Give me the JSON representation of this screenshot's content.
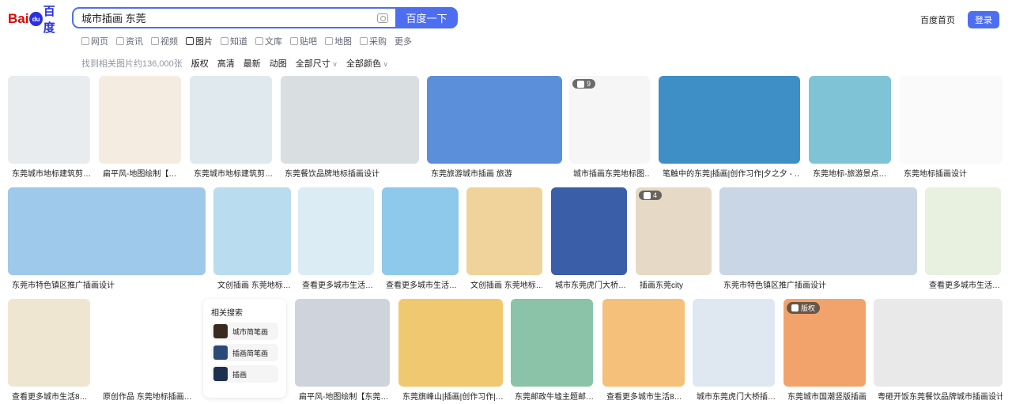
{
  "header": {
    "logo_bai": "Bai",
    "logo_du": "du",
    "logo_cn": "百度",
    "search_query": "城市插画 东莞",
    "search_button": "百度一下",
    "home_link": "百度首页",
    "login_button": "登录"
  },
  "tabs": [
    {
      "label": "网页",
      "icon": "search-icon"
    },
    {
      "label": "资讯",
      "icon": "news-icon"
    },
    {
      "label": "视频",
      "icon": "video-icon"
    },
    {
      "label": "图片",
      "icon": "image-icon",
      "active": true
    },
    {
      "label": "知道",
      "icon": "question-icon"
    },
    {
      "label": "文库",
      "icon": "document-icon"
    },
    {
      "label": "贴吧",
      "icon": "forum-icon"
    },
    {
      "label": "地图",
      "icon": "map-icon"
    },
    {
      "label": "采购",
      "icon": "shop-icon"
    },
    {
      "label": "更多",
      "icon": ""
    }
  ],
  "filters": {
    "count": "找到相关图片约136,000张",
    "copyright": "版权",
    "hd": "高清",
    "latest": "最新",
    "animated": "动图",
    "size": "全部尺寸",
    "color": "全部颜色"
  },
  "colors": {
    "accent": "#4e6ef2",
    "logo_red": "#e10601",
    "logo_blue": "#2932e1"
  },
  "images": [
    {
      "caption": "东莞城市地标建筑剪…",
      "bg": "#e8ecef"
    },
    {
      "caption": "扁平风-地图绘制【…",
      "bg": "#f4ece0"
    },
    {
      "caption": "东莞城市地标建筑剪…",
      "bg": "#dfe9ee"
    },
    {
      "caption": "东莞餐饮品牌地标插画设计",
      "bg": "#d9dfe0"
    },
    {
      "caption": "东莞旅游城市插画 旅游",
      "bg": "#5b8fd9"
    },
    {
      "caption": "城市插画东莞地标图…",
      "bg": "#f6f6f6",
      "badge": "9"
    },
    {
      "caption": "笔触中的东莞|插画|创作习作|夕之夕 - …",
      "bg": "#3f8fc7"
    },
    {
      "caption": "东莞地标-旅游景点…",
      "bg": "#7fc4d6"
    },
    {
      "caption": "东莞地标插画设计",
      "bg": "#fafafa"
    },
    {
      "caption": "东莞市特色镇区推广插画设计",
      "bg": "#9ec9ea"
    },
    {
      "caption": "文创插画 东莞地标…",
      "bg": "#b9dcee"
    },
    {
      "caption": "查看更多城市生活…",
      "bg": "#dcecf4"
    },
    {
      "caption": "查看更多城市生活…",
      "bg": "#8ec8ea"
    },
    {
      "caption": "文创插画 东莞地标…",
      "bg": "#f0d39a"
    },
    {
      "caption": "城市东莞虎门大桥…",
      "bg": "#3b5ea8"
    },
    {
      "caption": "插画东莞city",
      "bg": "#e6d9c6",
      "badge": "4"
    },
    {
      "caption": "东莞市特色镇区推广插画设计",
      "bg": "#c8d6e6"
    },
    {
      "caption": "查看更多城市生活…",
      "bg": "#e8f0e0"
    },
    {
      "caption": "查看更多城市生活8…",
      "bg": "#efe6d2"
    },
    {
      "caption": "原创作品 东莞地标插画…",
      "bg": "#ffffff"
    },
    {
      "caption": "扁平风-地图绘制【东莞…",
      "bg": "#cfd3db"
    },
    {
      "caption": "东莞旗峰山|插画|创作习作|…",
      "bg": "#f0c870"
    },
    {
      "caption": "东莞邮政牛墟主题邮…",
      "bg": "#8ac3a8"
    },
    {
      "caption": "查看更多城市生活8…",
      "bg": "#f5c07a"
    },
    {
      "caption": "城市东莞虎门大桥插…",
      "bg": "#dfe7f0"
    },
    {
      "caption": "东莞城市国潮竖版插画",
      "bg": "#f2a36b",
      "badge": "版权"
    },
    {
      "caption": "粤砸开饭东莞餐饮品牌城市插画设计",
      "bg": "#e9e9e9"
    }
  ],
  "related": {
    "title": "相关搜索",
    "items": [
      {
        "label": "城市简笔画"
      },
      {
        "label": "插画简笔画"
      },
      {
        "label": "插画"
      }
    ]
  }
}
